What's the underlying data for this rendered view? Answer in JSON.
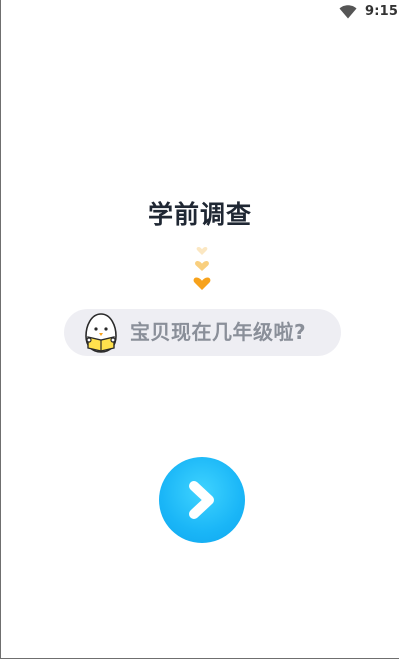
{
  "status_bar": {
    "time": "9:15",
    "wifi_icon": "wifi-icon"
  },
  "page": {
    "title": "学前调查"
  },
  "question": {
    "text": "宝贝现在几年级啦?",
    "avatar_icon": "egg-mascot-icon"
  },
  "decoration": {
    "hearts_icon": "stacked-hearts-icon",
    "colors": [
      "#fbe7c2",
      "#f9cf7e",
      "#f7a21b"
    ]
  },
  "next_button": {
    "icon": "chevron-right-icon",
    "color": "#1ab6f7"
  }
}
